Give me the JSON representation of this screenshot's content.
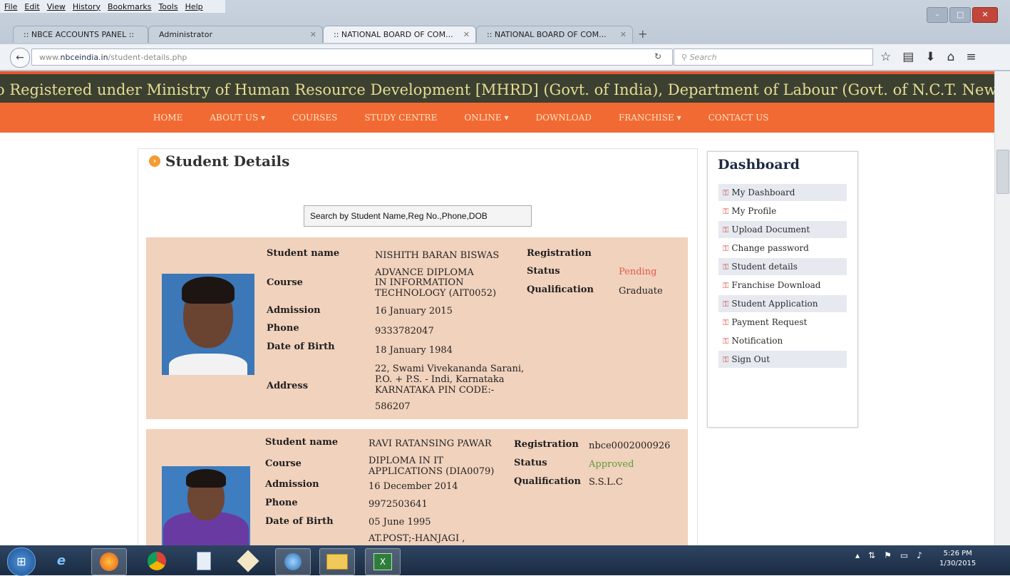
{
  "menubar": {
    "items": [
      "File",
      "Edit",
      "View",
      "History",
      "Bookmarks",
      "Tools",
      "Help"
    ]
  },
  "tabs": [
    {
      "label": ":: NBCE ACCOUNTS PANEL ::"
    },
    {
      "label": "Administrator"
    },
    {
      "label": ":: NATIONAL BOARD OF COM..."
    },
    {
      "label": ":: NATIONAL BOARD OF COM..."
    }
  ],
  "navbar": {
    "url_prefix": "www.",
    "url_domain": "nbceindia.in",
    "url_path": "/student-details.php",
    "search_placeholder": "Search"
  },
  "banner": {
    "text": "o Registered under Ministry of Human Resource Development [MHRD] (Govt. of India), Department of Labour (Govt. of N.C.T. New Delhi), Planni"
  },
  "site_nav": {
    "items": [
      "HOME",
      "ABOUT US ▾",
      "COURSES",
      "STUDY CENTRE",
      "ONLINE ▾",
      "DOWNLOAD",
      "FRANCHISE ▾",
      "CONTACT US"
    ]
  },
  "page": {
    "title": "Student Details",
    "search_value": "Search by Student Name,Reg No.,Phone,DOB"
  },
  "labels": {
    "student_name": "Student name",
    "course": "Course",
    "admission": "Admission",
    "phone": "Phone",
    "dob": "Date of Birth",
    "address": "Address",
    "registration": "Registration",
    "status": "Status",
    "qualification": "Qualification"
  },
  "students": [
    {
      "name": "NISHITH BARAN BISWAS",
      "course_lines": [
        "ADVANCE DIPLOMA",
        "IN INFORMATION",
        "TECHNOLOGY (AIT0052)"
      ],
      "admission": "16 January 2015",
      "phone": "9333782047",
      "dob": "18 January 1984",
      "address_lines": [
        "22, Swami Vivekananda Sarani,",
        "P.O. + P.S. - Indi, Karnataka",
        "KARNATAKA PIN CODE:-",
        "586207"
      ],
      "registration": "",
      "status": "Pending",
      "qualification": "Graduate"
    },
    {
      "name": "RAVI RATANSING PAWAR",
      "course_lines": [
        "DIPLOMA IN IT",
        "APPLICATIONS (DIA0079)"
      ],
      "admission": "16 December 2014",
      "phone": "9972503641",
      "dob": "05 June 1995",
      "address_lines": [
        "AT.POST;-HANJAGI ,"
      ],
      "registration": "nbce0002000926",
      "status": "Approved",
      "qualification": "S.S.L.C"
    }
  ],
  "dashboard": {
    "title": "Dashboard",
    "items": [
      "My Dashboard",
      "My Profile",
      "Upload Document",
      "Change password",
      "Student details",
      "Franchise Download",
      "Student Application",
      "Payment Request",
      "Notification",
      "Sign Out"
    ]
  },
  "taskbar": {
    "time": "5:26 PM",
    "date": "1/30/2015"
  },
  "colors": {
    "accent_orange": "#f26a33",
    "banner_dark": "#3b4031",
    "card_bg": "#f1d2bd",
    "pending": "#e05a4e",
    "approved": "#5b9b3a"
  }
}
